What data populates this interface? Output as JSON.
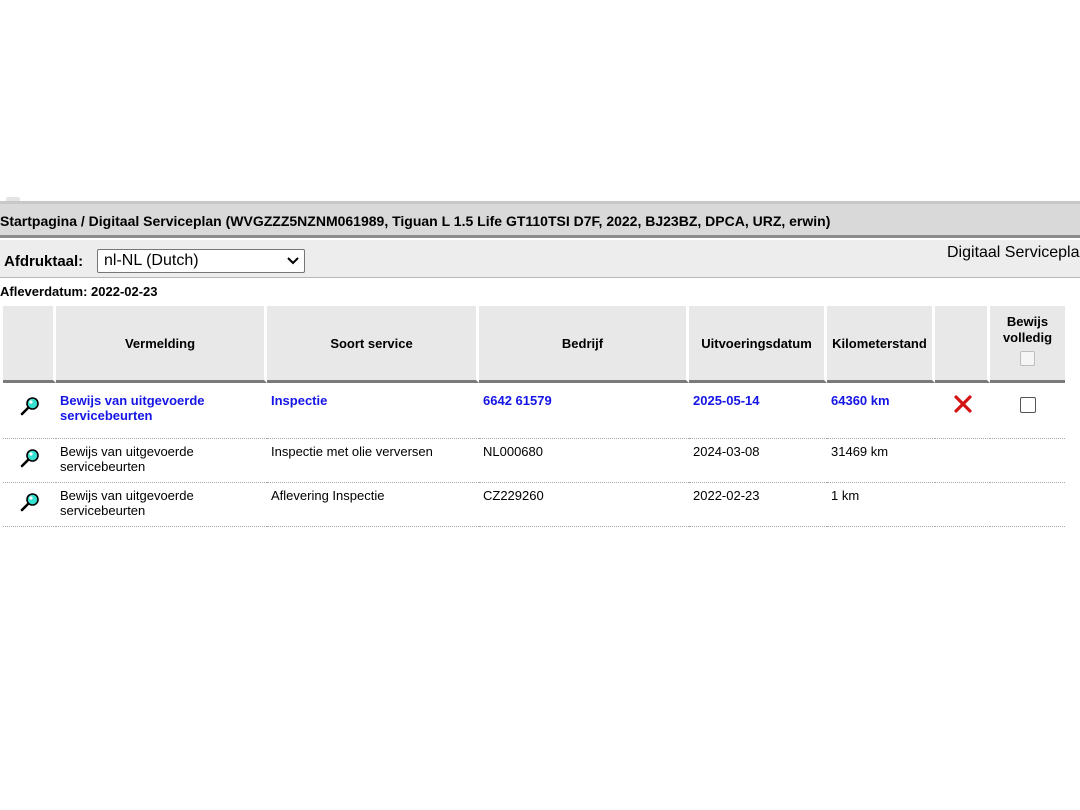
{
  "breadcrumb": "Startpagina / Digitaal Serviceplan (WVGZZZ5NZNM061989, Tiguan L 1.5 Life GT110TSI D7F, 2022, BJ23BZ, DPCA, URZ, erwin)",
  "print_language": {
    "label": "Afdruktaal:",
    "selected": "nl-NL (Dutch)"
  },
  "right_title": "Digitaal Serviceplan",
  "delivery_date": "Afleverdatum: 2022-02-23",
  "table": {
    "headers": {
      "entry": "Vermelding",
      "service_type": "Soort service",
      "company": "Bedrijf",
      "date": "Uitvoeringsdatum",
      "mileage": "Kilometerstand",
      "proof_complete_line1": "Bewijs",
      "proof_complete_line2": "volledig"
    },
    "rows": [
      {
        "entry": "Bewijs van uitgevoerde servicebeurten",
        "service_type": "Inspectie",
        "company": "6642 61579",
        "date": "2025-05-14",
        "mileage": "64360 km",
        "deletable": true,
        "highlight_color": "#1515e6"
      },
      {
        "entry": "Bewijs van uitgevoerde servicebeurten",
        "service_type": "Inspectie met olie verversen",
        "company": "NL000680",
        "date": "2024-03-08",
        "mileage": "31469 km"
      },
      {
        "entry": "Bewijs van uitgevoerde servicebeurten",
        "service_type": "Aflevering Inspectie",
        "company": "CZ229260",
        "date": "2022-02-23",
        "mileage": "1 km"
      }
    ]
  },
  "icons": {
    "view": "magnifier-icon",
    "delete": "red-x-delete-icon",
    "dropdown": "chevron-down-icon"
  }
}
